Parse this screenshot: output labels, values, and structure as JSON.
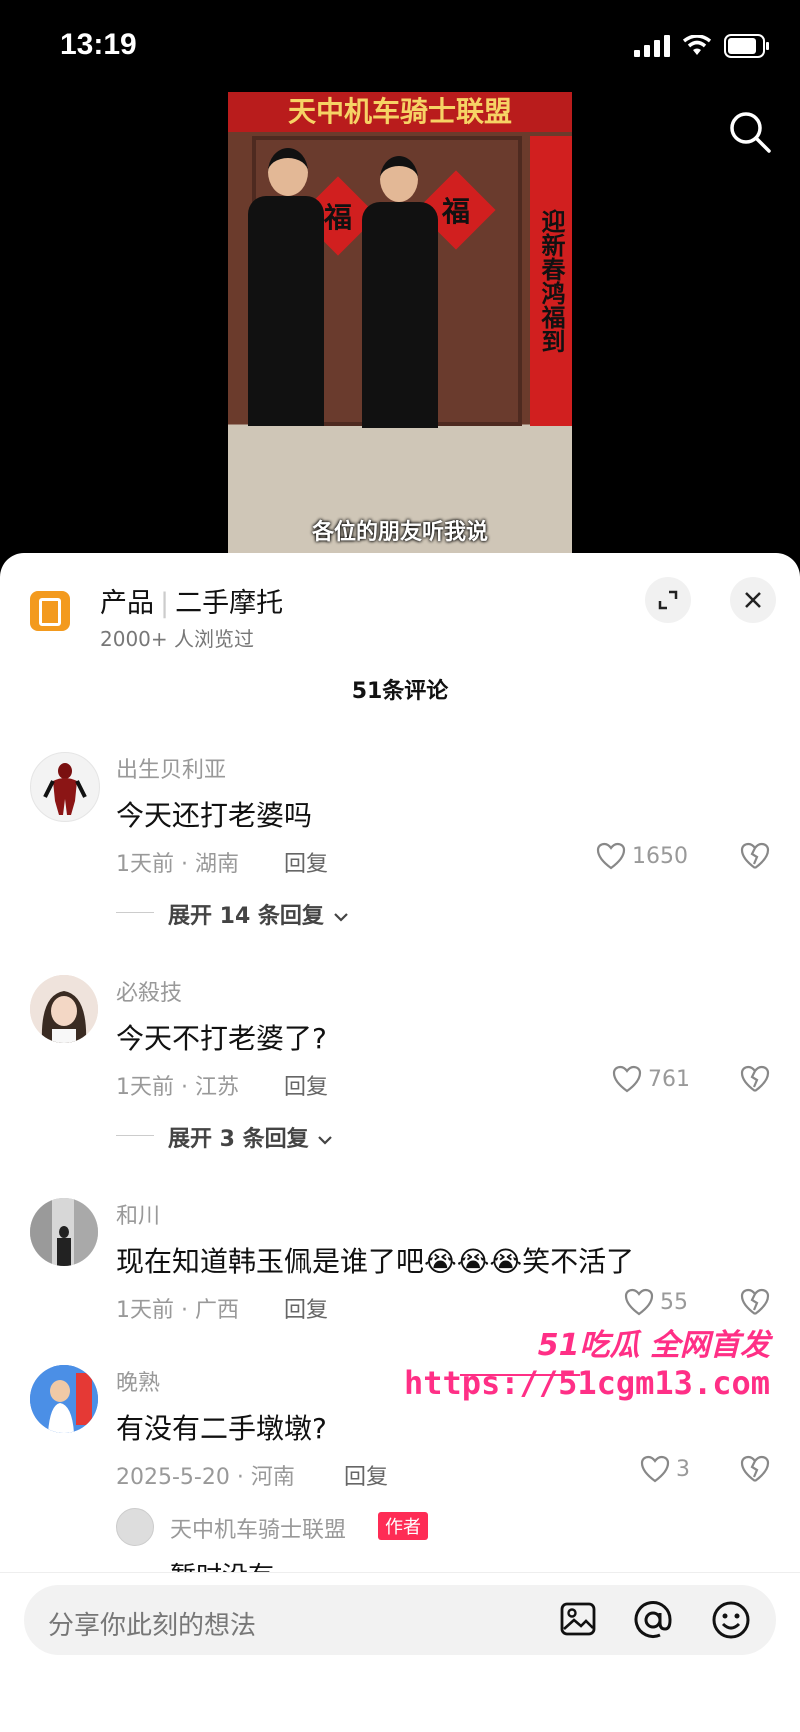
{
  "status_bar": {
    "time": "13:19"
  },
  "video": {
    "banner": "天中机车骑士联盟",
    "couplet": "迎新春鸿福到",
    "fu": "福",
    "caption": "各位的朋友听我说"
  },
  "product": {
    "label": "产品",
    "name": "二手摩托",
    "views": "2000+ 人浏览过"
  },
  "comments_count": "51条评论",
  "comments": [
    {
      "user": "出生贝利亚",
      "text": "今天还打老婆吗",
      "meta": "1天前 · 湖南",
      "reply": "回复",
      "likes": "1650",
      "expand": "展开 14 条回复"
    },
    {
      "user": "必殺技",
      "text": "今天不打老婆了?",
      "meta": "1天前 · 江苏",
      "reply": "回复",
      "likes": "761",
      "expand": "展开 3 条回复"
    },
    {
      "user": "和川",
      "text": "现在知道韩玉佩是谁了吧😭😭😭笑不活了",
      "meta": "1天前 · 广西",
      "reply": "回复",
      "likes": "55"
    },
    {
      "user": "晚熟",
      "text": "有没有二手墩墩?",
      "meta": "2025-5-20 · 河南",
      "reply": "回复",
      "likes": "3"
    }
  ],
  "sub_reply": {
    "user": "天中机车骑士联盟",
    "tag": "作者",
    "text": "暂时没有"
  },
  "watermark": {
    "line1": "51吃瓜 全网首发",
    "line2": "https://51cgm13.com"
  },
  "input": {
    "placeholder": "分享你此刻的想法"
  },
  "icons": [
    "search-icon",
    "expand-icon",
    "close-icon",
    "heart-icon",
    "broken-heart-icon",
    "image-icon",
    "at-icon",
    "emoji-icon"
  ]
}
